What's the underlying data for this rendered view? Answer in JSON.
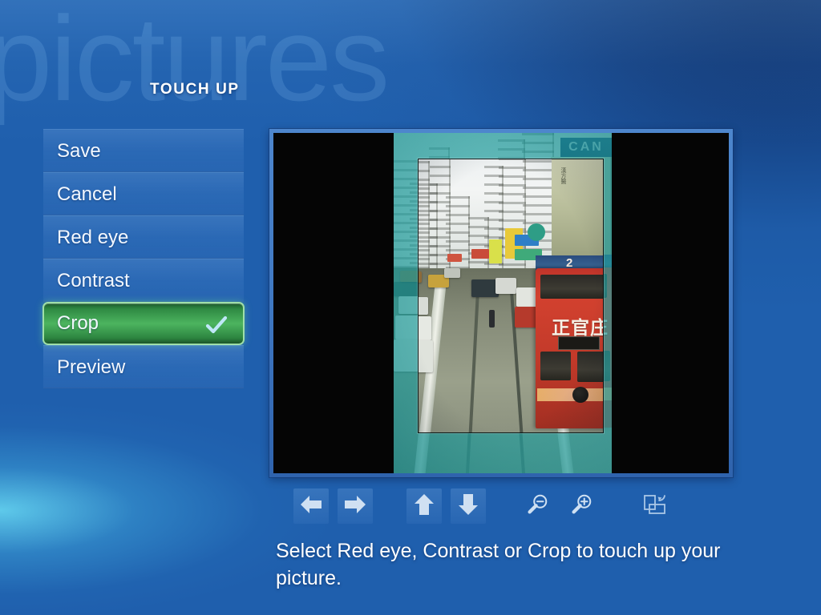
{
  "app": {
    "watermark": "pictures",
    "page_title": "TOUCH UP",
    "accent_selected": "#4cb45f",
    "background_color": "#1f5fad",
    "text_color": "#ffffff"
  },
  "menu": {
    "items": [
      {
        "label": "Save",
        "icon": "",
        "selected": false
      },
      {
        "label": "Cancel",
        "icon": "",
        "selected": false
      },
      {
        "label": "Red eye",
        "icon": "",
        "selected": false
      },
      {
        "label": "Contrast",
        "icon": "",
        "selected": false
      },
      {
        "label": "Crop",
        "icon": "check-icon",
        "selected": true
      },
      {
        "label": "Preview",
        "icon": "",
        "selected": false
      }
    ]
  },
  "preview": {
    "mode": "crop",
    "photo": {
      "description": "Hong Kong street scene with red double-decker tram",
      "tram_route_number": "2",
      "tram_ad_text": "正官庄",
      "billboard_text": "CAN"
    }
  },
  "toolbar": {
    "buttons": [
      {
        "name": "pan-left-button",
        "icon": "arrow-left-icon",
        "label": "Left"
      },
      {
        "name": "pan-right-button",
        "icon": "arrow-right-icon",
        "label": "Right"
      },
      {
        "name": "pan-up-button",
        "icon": "arrow-up-icon",
        "label": "Up"
      },
      {
        "name": "pan-down-button",
        "icon": "arrow-down-icon",
        "label": "Down"
      },
      {
        "name": "zoom-out-button",
        "icon": "magnifier-minus-icon",
        "label": "Zoom out"
      },
      {
        "name": "zoom-in-button",
        "icon": "magnifier-plus-icon",
        "label": "Zoom in"
      },
      {
        "name": "rotate-button",
        "icon": "rotate-icon",
        "label": "Rotate"
      }
    ]
  },
  "caption": {
    "text": "Select Red eye, Contrast or Crop to touch up your picture."
  }
}
